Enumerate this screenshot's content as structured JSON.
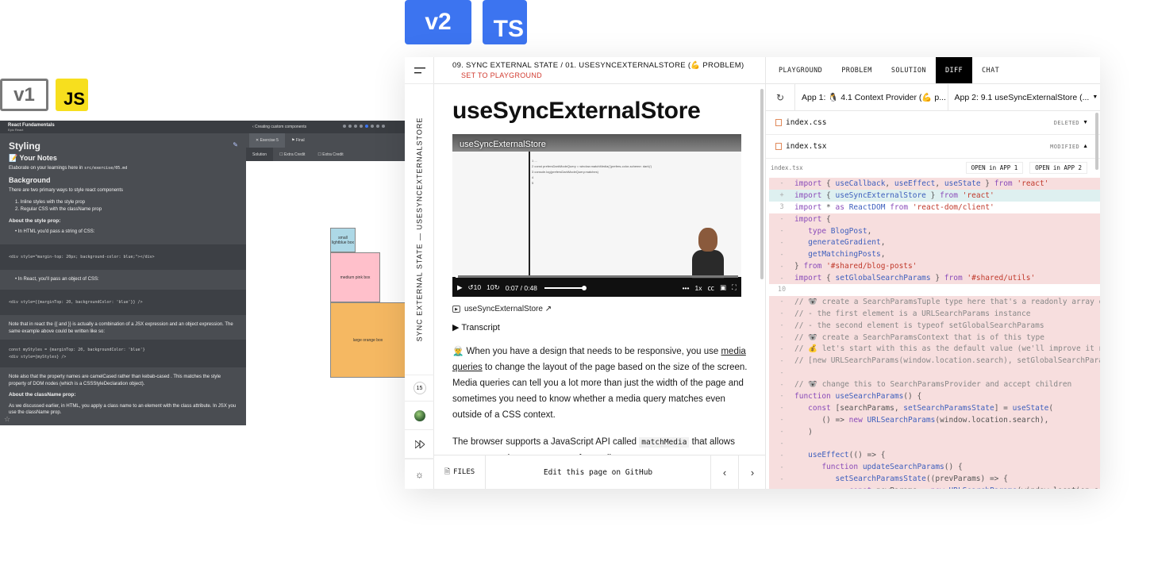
{
  "badges": {
    "v1": "v1",
    "js": "JS",
    "v2": "v2",
    "ts": "TS"
  },
  "v1": {
    "workshop": "React Fundamentals",
    "workshop_sub": "Epic React",
    "title": "Styling",
    "notes_heading": "📝 Your Notes",
    "notes_text": "Elaborate on your learnings here in",
    "notes_path": "src/exercise/05.md",
    "background_heading": "Background",
    "background_text": "There are two primary ways to style react components",
    "list": [
      "1. Inline styles with the style prop",
      "2. Regular CSS with the className prop"
    ],
    "about_style": "About the style prop:",
    "html_bullet": "In HTML you'd pass a string of CSS:",
    "html_code": "<div style=\"margin-top: 20px; background-color: blue;\"></div>",
    "react_bullet": "In React, you'll pass an object of CSS:",
    "react_code": "<div style={{marginTop: 20, backgroundColor: 'blue'}} />",
    "note1": "Note that in react the {{ and }} is actually a combination of a JSX expression and an object expression. The same example above could be written like so:",
    "code2_line1": "const myStyles = {marginTop: 20, backgroundColor: 'blue'}",
    "code2_line2": "<div style={myStyles} />",
    "note2": "Note also that the property names are camelCased rather than kebab-cased . This matches the style property of DOM nodes (which is a CSSStyleDeclaration object).",
    "about_classname": "About the className prop:",
    "classname_text1": "As we discussed earlier, in HTML, you apply a class name to an element with the class attribute.",
    "classname_text2": "In JSX you use the className prop.",
    "step_title": "‹ Creating custom components",
    "tabs": [
      "Exercise 5",
      "Final"
    ],
    "subtabs": [
      "Solution",
      "Extra Credit",
      "Extra Credit"
    ],
    "boxes": {
      "small": "small lightblue box",
      "medium": "medium pink box",
      "large": "large orange box"
    }
  },
  "v2": {
    "breadcrumb": "09. SYNC EXTERNAL STATE  /  01. USESYNCEXTERNALSTORE (💪 PROBLEM)",
    "set_playground": "SET TO PLAYGROUND",
    "vertical_label": "SYNC EXTERNAL STATE — USESYNCEXTERNALSTORE",
    "count": "15",
    "title": "useSyncExternalStore",
    "video": {
      "title": "useSyncExternalStore",
      "time": "0:07 / 0:48",
      "speed": "1x",
      "back": "10",
      "forward": "10"
    },
    "video_link": "useSyncExternalStore ↗",
    "transcript": "▶ Transcript",
    "para1_prefix": "🧝‍♂️ When you have a design that needs to be responsive, you use",
    "para1_link": "media queries",
    "para1_suffix": "to change the layout of the page based on the size of the screen. Media queries can tell you a lot more than just the width of the page and sometimes you need to know whether a media query matches even outside of a CSS context.",
    "para2_prefix": "The browser supports a JavaScript API called",
    "para2_code": "matchMedia",
    "para2_suffix": "that allows you to query the current state of a media query:",
    "footer": {
      "files": "FILES",
      "edit": "Edit this page on GitHub"
    },
    "tabs": [
      "PLAYGROUND",
      "PROBLEM",
      "SOLUTION",
      "DIFF",
      "CHAT"
    ],
    "app1": "App 1: 🐧 4.1 Context Provider (💪 p...",
    "app2": "App 2: 9.1 useSyncExternalStore (...",
    "files": [
      {
        "name": "index.css",
        "status": "DELETED"
      },
      {
        "name": "index.tsx",
        "status": "MODIFIED"
      }
    ],
    "diff_file": "index.tsx",
    "open1": "OPEN in APP 1",
    "open2": "OPEN in APP 2",
    "diff_lines": [
      {
        "t": "rem",
        "g": "-",
        "c": "import { useCallback, useEffect, useState } from 'react'"
      },
      {
        "t": "add",
        "g": "+",
        "c": "import { useSyncExternalStore } from 'react'"
      },
      {
        "t": "ctx",
        "g": "3",
        "c": "import * as ReactDOM from 'react-dom/client'"
      },
      {
        "t": "rem",
        "g": "-",
        "c": "import {"
      },
      {
        "t": "rem",
        "g": "-",
        "c": "   type BlogPost,"
      },
      {
        "t": "rem",
        "g": "-",
        "c": "   generateGradient,"
      },
      {
        "t": "rem",
        "g": "-",
        "c": "   getMatchingPosts,"
      },
      {
        "t": "rem",
        "g": "-",
        "c": "} from '#shared/blog-posts'"
      },
      {
        "t": "rem",
        "g": "-",
        "c": "import { setGlobalSearchParams } from '#shared/utils'"
      },
      {
        "t": "ctx",
        "g": "10",
        "c": ""
      },
      {
        "t": "rem",
        "g": "-",
        "c": "// 🐨 create a SearchParamsTuple type here that's a readonly array of tw"
      },
      {
        "t": "rem",
        "g": "-",
        "c": "// - the first element is a URLSearchParams instance"
      },
      {
        "t": "rem",
        "g": "-",
        "c": "// - the second element is typeof setGlobalSearchParams"
      },
      {
        "t": "rem",
        "g": "-",
        "c": "// 🐨 create a SearchParamsContext that is of this type"
      },
      {
        "t": "rem",
        "g": "-",
        "c": "// 💰 let's start with this as the default value (we'll improve it next)"
      },
      {
        "t": "rem",
        "g": "-",
        "c": "// [new URLSearchParams(window.location.search), setGlobalSearchParams]"
      },
      {
        "t": "rem",
        "g": "-",
        "c": ""
      },
      {
        "t": "rem",
        "g": "-",
        "c": "// 🐨 change this to SearchParamsProvider and accept children"
      },
      {
        "t": "rem",
        "g": "-",
        "c": "function useSearchParams() {"
      },
      {
        "t": "rem",
        "g": "-",
        "c": "   const [searchParams, setSearchParamsState] = useState("
      },
      {
        "t": "rem",
        "g": "-",
        "c": "      () => new URLSearchParams(window.location.search),"
      },
      {
        "t": "rem",
        "g": "-",
        "c": "   )"
      },
      {
        "t": "rem",
        "g": "-",
        "c": ""
      },
      {
        "t": "rem",
        "g": "-",
        "c": "   useEffect(() => {"
      },
      {
        "t": "rem",
        "g": "-",
        "c": "      function updateSearchParams() {"
      },
      {
        "t": "rem",
        "g": "-",
        "c": "         setSearchParamsState((prevParams) => {"
      },
      {
        "t": "rem",
        "g": "-",
        "c": "            const newParams = new URLSearchParams(window.location.search)"
      }
    ]
  }
}
